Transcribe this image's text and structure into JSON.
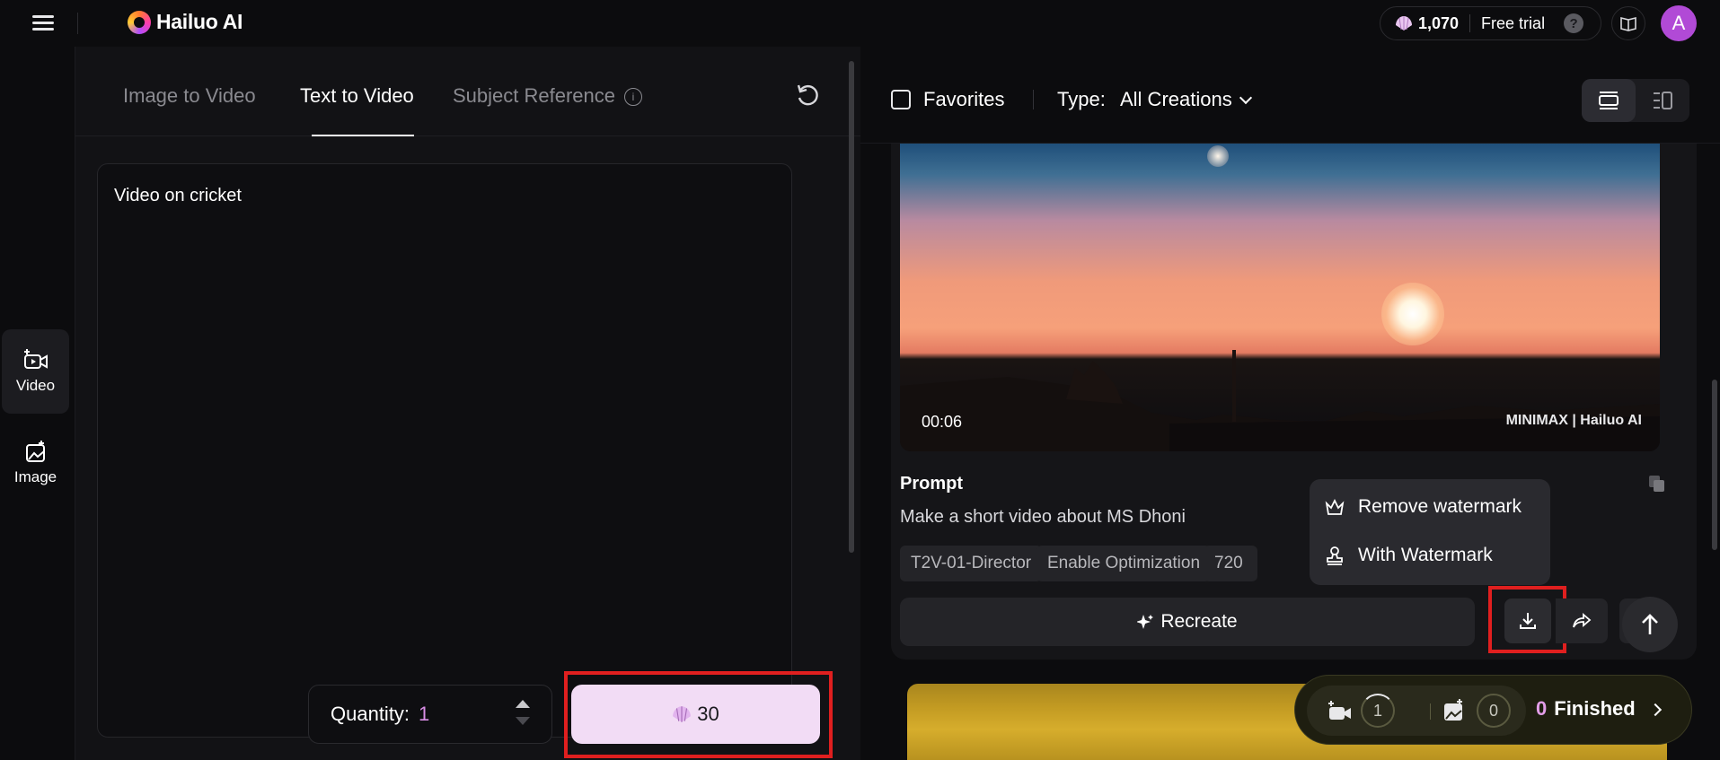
{
  "header": {
    "app_name": "Hailuo AI",
    "credits": "1,070",
    "plan": "Free trial",
    "help_glyph": "?",
    "avatar_letter": "A"
  },
  "rail": {
    "items": [
      {
        "label": "Video",
        "icon": "video-icon"
      },
      {
        "label": "Image",
        "icon": "image-icon"
      }
    ]
  },
  "composer": {
    "tabs": [
      {
        "label": "Image to Video"
      },
      {
        "label": "Text to Video"
      },
      {
        "label": "Subject Reference"
      }
    ],
    "active_tab": "Text to Video",
    "prompt_value": "Video on cricket",
    "quantity_label": "Quantity:",
    "quantity_value": "1",
    "generate_cost": "30"
  },
  "results": {
    "favorites_label": "Favorites",
    "type_label": "Type:",
    "type_value": "All Creations",
    "card": {
      "duration": "00:06",
      "watermark": "MINIMAX | Hailuo AI",
      "prompt_title": "Prompt",
      "prompt_text": "Make a short video about MS Dhoni",
      "tags": [
        "T2V-01-Director",
        "Enable Optimization",
        "720"
      ],
      "recreate_label": "Recreate"
    },
    "download_menu": {
      "remove_watermark": "Remove watermark",
      "with_watermark": "With Watermark"
    }
  },
  "status": {
    "video_count": "1",
    "image_count": "0",
    "finished_count": "0",
    "finished_label": "Finished"
  },
  "colors": {
    "accent_pink": "#d98ee6",
    "generate_bg": "#f2dcf5",
    "avatar_bg": "#b14ad6",
    "highlight_red": "#e01f1f"
  }
}
